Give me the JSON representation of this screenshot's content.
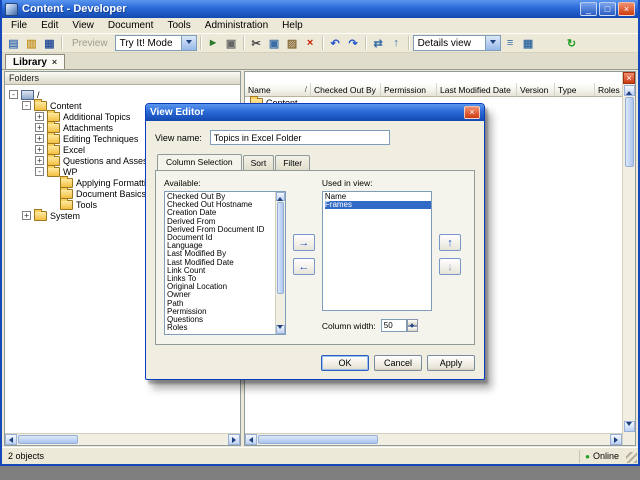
{
  "window": {
    "title": "Content - Developer"
  },
  "menu": {
    "items": [
      "File",
      "Edit",
      "View",
      "Document",
      "Tools",
      "Administration",
      "Help"
    ]
  },
  "toolbar": {
    "preview_label": "Preview",
    "tryit_mode_value": "Try It! Mode",
    "details_view_value": "Details view"
  },
  "tab": {
    "label": "Library"
  },
  "folders_panel": {
    "header": "Folders",
    "tree": [
      {
        "label": "/"
      },
      {
        "label": "Content"
      },
      {
        "label": "Additional Topics"
      },
      {
        "label": "Attachments"
      },
      {
        "label": "Editing Techniques"
      },
      {
        "label": "Excel"
      },
      {
        "label": "Questions and Assessments"
      },
      {
        "label": "WP"
      },
      {
        "label": "Applying Formatting"
      },
      {
        "label": "Document Basics"
      },
      {
        "label": "Tools"
      },
      {
        "label": "System"
      }
    ]
  },
  "list_panel": {
    "columns": [
      "Name",
      "Checked Out By",
      "Permission",
      "Last Modified Date",
      "Version",
      "Type",
      "Roles"
    ],
    "sort_glyph": "/",
    "rows": [
      {
        "name": "Content"
      }
    ]
  },
  "dialog": {
    "title": "View Editor",
    "view_name_label": "View name:",
    "view_name_value": "Topics in Excel Folder",
    "tabs": [
      "Column Selection",
      "Sort",
      "Filter"
    ],
    "available_label": "Available:",
    "available_items": [
      "Checked Out By",
      "Checked Out Hostname",
      "Creation Date",
      "Derived From",
      "Derived From Document ID",
      "Document Id",
      "Language",
      "Last Modified By",
      "Last Modified Date",
      "Link Count",
      "Links To",
      "Original Location",
      "Owner",
      "Path",
      "Permission",
      "Questions",
      "Roles"
    ],
    "used_label": "Used in view:",
    "used_items": [
      "Name",
      "Frames"
    ],
    "selected_used_item": "Frames",
    "column_width_label": "Column width:",
    "column_width_value": "50",
    "ok_label": "OK",
    "cancel_label": "Cancel",
    "apply_label": "Apply"
  },
  "status_bar": {
    "objects": "2 objects",
    "online": "Online"
  },
  "icons": {
    "minimize": "_",
    "maximize": "□",
    "close": "×",
    "expander_minus": "-",
    "expander_plus": "+",
    "tab_close": "×",
    "pane_close": "×",
    "new_document": "▤",
    "open": "▥",
    "save": "▦",
    "play": "►",
    "print": "▣",
    "cut": "✂",
    "copy": "▣",
    "paste": "▨",
    "delete": "×",
    "undo": "↶",
    "redo": "↷",
    "link": "⇄",
    "up_level": "↑",
    "list_view": "≡",
    "grid_view": "▦",
    "refresh": "↻",
    "arrow_right": "→",
    "arrow_left": "←",
    "arrow_up": "↑",
    "arrow_down": "↓",
    "online_dot": "●"
  }
}
